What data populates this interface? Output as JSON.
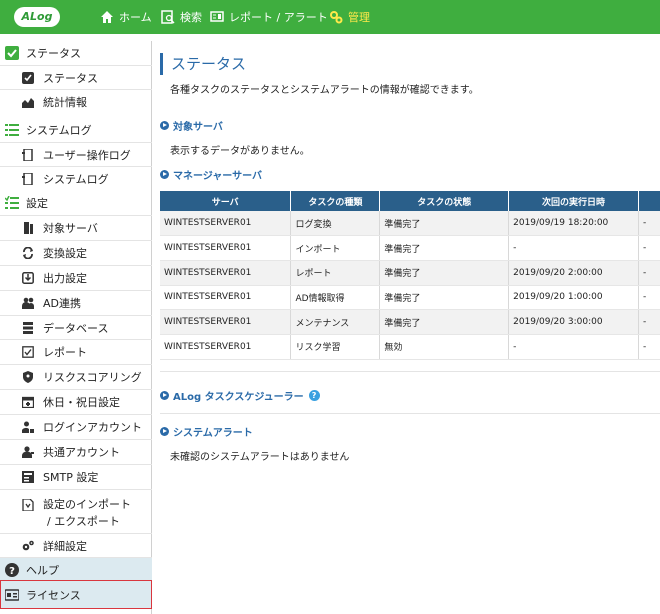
{
  "header": {
    "logo": "ALog",
    "nav": [
      {
        "label": "ホーム",
        "icon": "home-icon"
      },
      {
        "label": "検索",
        "icon": "search-icon"
      },
      {
        "label": "レポート / アラート",
        "icon": "report-icon"
      },
      {
        "label": "管理",
        "icon": "admin-icon",
        "active": true
      }
    ],
    "colors": {
      "bar": "#3fae3f",
      "active": "#ffe94a"
    }
  },
  "sidebar": {
    "status_section": "ステータス",
    "status_items": [
      "ステータス",
      "統計情報"
    ],
    "syslog_section": "システムログ",
    "syslog_items": [
      "ユーザー操作ログ",
      "システムログ"
    ],
    "settings_section": "設定",
    "settings_items": [
      "対象サーバ",
      "変換設定",
      "出力設定",
      "AD連携",
      "データベース",
      "レポート",
      "リスクスコアリング",
      "休日・祝日設定",
      "ログインアカウント",
      "共通アカウント",
      "SMTP 設定"
    ],
    "import_export_line1": "設定のインポート",
    "import_export_line2": "/ エクスポート",
    "advanced": "詳細設定",
    "help": "ヘルプ",
    "license": "ライセンス"
  },
  "main": {
    "title": "ステータス",
    "description": "各種タスクのステータスとシステムアラートの情報が確認できます。",
    "target_server_heading": "対象サーバ",
    "target_server_empty": "表示するデータがありません。",
    "manager_heading": "マネージャーサーバ",
    "table": {
      "headers": [
        "サーバ",
        "タスクの種類",
        "タスクの状態",
        "次回の実行日時",
        ""
      ],
      "rows": [
        [
          "WINTESTSERVER01",
          "ログ変換",
          "準備完了",
          "2019/09/19 18:20:00",
          "-"
        ],
        [
          "WINTESTSERVER01",
          "インポート",
          "準備完了",
          "-",
          "-"
        ],
        [
          "WINTESTSERVER01",
          "レポート",
          "準備完了",
          "2019/09/20 2:00:00",
          "-"
        ],
        [
          "WINTESTSERVER01",
          "AD情報取得",
          "準備完了",
          "2019/09/20 1:00:00",
          "-"
        ],
        [
          "WINTESTSERVER01",
          "メンテナンス",
          "準備完了",
          "2019/09/20 3:00:00",
          "-"
        ],
        [
          "WINTESTSERVER01",
          "リスク学習",
          "無効",
          "-",
          "-"
        ]
      ]
    },
    "scheduler_heading": "ALog タスクスケジューラー",
    "scheduler_help": "?",
    "alert_heading": "システムアラート",
    "alert_empty": "未確認のシステムアラートはありません"
  }
}
